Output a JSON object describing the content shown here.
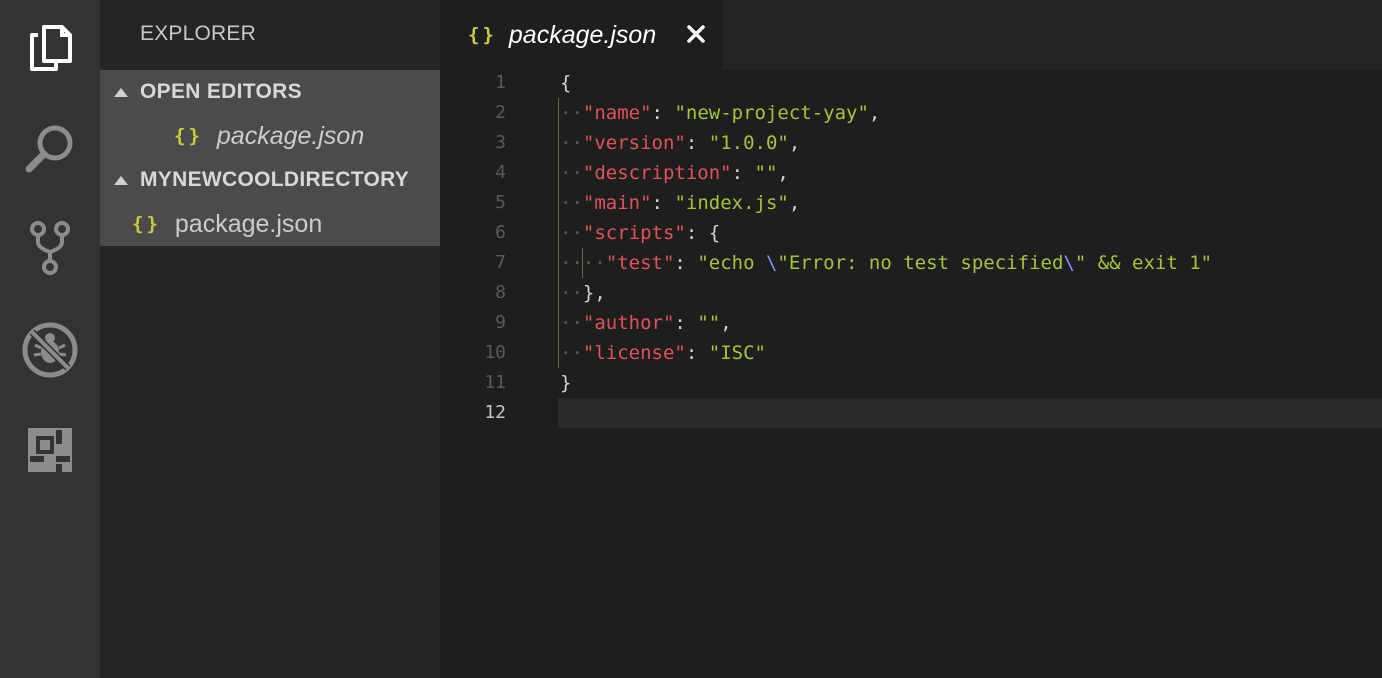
{
  "sidebar": {
    "title": "EXPLORER",
    "open_editors_label": "OPEN EDITORS",
    "open_editor_file": "package.json",
    "folder_label": "MYNEWCOOLDIRECTORY",
    "folder_file": "package.json",
    "file_icon": "{}"
  },
  "activity_bar": {
    "icons": [
      "files-icon",
      "search-icon",
      "source-control-icon",
      "debug-icon",
      "extensions-icon"
    ]
  },
  "editor": {
    "tab_label": "package.json",
    "tab_icon": "{}",
    "close_glyph": "✕",
    "line_numbers": [
      "1",
      "2",
      "3",
      "4",
      "5",
      "6",
      "7",
      "8",
      "9",
      "10",
      "11",
      "12"
    ],
    "active_line": "12",
    "lines": [
      "{",
      "  \"name\": \"new-project-yay\",",
      "  \"version\": \"1.0.0\",",
      "  \"description\": \"\",",
      "  \"main\": \"index.js\",",
      "  \"scripts\": {",
      "    \"test\": \"echo \\\"Error: no test specified\\\" && exit 1\"",
      "  },",
      "  \"author\": \"\",",
      "  \"license\": \"ISC\"",
      "}",
      ""
    ]
  },
  "colors": {
    "activity_bg": "#333333",
    "sidebar_bg": "#252526",
    "editor_bg": "#1e1e1e",
    "json_key": "#e0535c",
    "json_string": "#a6c43a",
    "json_escape": "#8f8ff5",
    "braces_icon": "#cbcb41"
  }
}
